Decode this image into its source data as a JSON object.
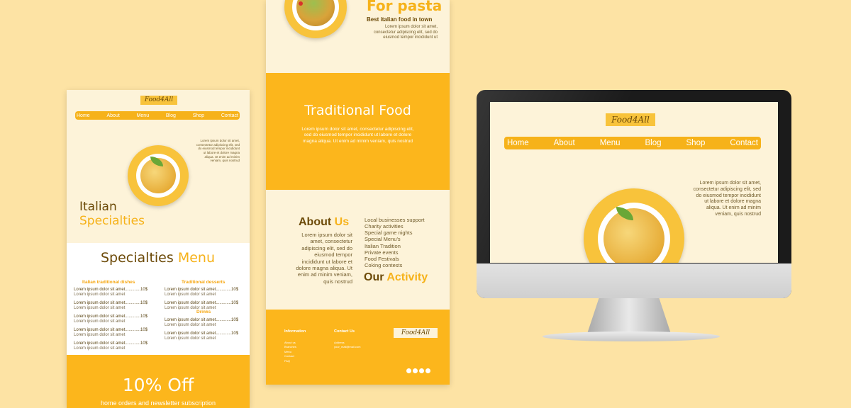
{
  "brand": "Food4All",
  "nav": [
    "Home",
    "About",
    "Menu",
    "Blog",
    "Shop",
    "Contact"
  ],
  "lorem_hero": [
    "Lorem ipsum dolor sit amet,",
    "consectetur adipiscing elit, sed",
    "do eiusmod tempor incididunt",
    "ut labore et dolore magna",
    "aliqua. Ut enim ad minim",
    "veniam, quis nostrud"
  ],
  "mobile": {
    "hero_title_1": "Italian",
    "hero_title_2": "Specialties",
    "menu_title_1": "Specialties",
    "menu_title_2": "Menu",
    "col1_heading": "Italian traditional dishes",
    "col2_heading": "Traditional desserts",
    "drinks_heading": "Drinks",
    "item_line": "Lorem ipsum dolor sit amet.............10$",
    "item_sub": "Lorem ipsum dolor sit amet",
    "promo_title": "10% Off",
    "promo_sub": "home orders and newsletter subscription"
  },
  "tablet": {
    "top_title": "For pasta",
    "top_sub": "Best italian food in town",
    "top_lorem": [
      "Lorem ipsum dolor sit amet,",
      "consectetur adipiscing elit, sed do",
      "eiusmod tempor incididunt ut"
    ],
    "band_title": "Traditional Food",
    "band_lorem": [
      "Lorem ipsum dolor sit amet, consectetur adipiscing elit,",
      "sed do eiusmod tempor incididunt ut labore et dolore",
      "magna aliqua. Ut enim ad minim veniam, quis nostrud"
    ],
    "about_1": "About",
    "about_2": "Us",
    "about_lorem": [
      "Lorem ipsum dolor sit",
      "amet, consectetur",
      "adipiscing elit, sed do",
      "eiusmod tempor",
      "incididunt ut labore et",
      "dolore magna aliqua. Ut",
      "enim ad minim veniam,",
      "quis nostrud"
    ],
    "activities": [
      "Local businesses support",
      "Charity activities",
      "Special game nights",
      "Special Menu's",
      "Italian Tradition",
      "Private events",
      "Food Festivals",
      "Coking contests"
    ],
    "activity_1": "Our",
    "activity_2": "Activity",
    "footer_info": "Information",
    "footer_contact": "Contact Us",
    "footer_links": [
      "About us",
      "Branches",
      "Menu",
      "Contact",
      "FAQ"
    ],
    "footer_contact_lines": [
      "Address",
      "your_mail@mail.com"
    ]
  },
  "colors": {
    "accent": "#f6b21a",
    "brown": "#6c4a08",
    "cream": "#fdf3d9",
    "background": "#fde3a4"
  }
}
